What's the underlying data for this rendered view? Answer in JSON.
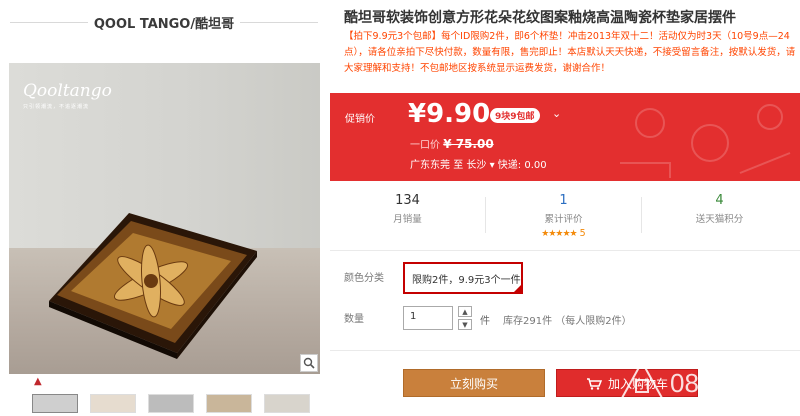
{
  "store": {
    "name": "QOOL TANGO/酷坦哥"
  },
  "gallery": {
    "brand_logo": "Qooltango",
    "brand_slogan": "只引领潮流，不追逐潮流",
    "zoom_icon": "magnifier-icon",
    "up_icon": "chevron-up-icon",
    "thumbnail_count": 5
  },
  "product": {
    "title": "酷坦哥软装饰创意方形花朵花纹图案釉烧高温陶瓷杯垫家居摆件",
    "promo_text": "【拍下9.9元3个包邮】每个ID限购2件，即6个杯垫！冲击2013年双十二！活动仅为时3天（10号9点—24点），请各位亲拍下尽快付款，数量有限，售完即止！本店默认天天快递，不接受留言备注，按默认发货，请大家理解和支持！不包邮地区按系统显示运费发货，谢谢合作！"
  },
  "price": {
    "promo_label": "促销价",
    "current": "¥9.90",
    "badge": "9块9包邮",
    "original_label": "一口价",
    "original_value": "¥ 75.00",
    "ship_from": "广东东莞",
    "to_label": "至",
    "ship_to": "长沙",
    "shipping": "快递: 0.00"
  },
  "stats": {
    "sales": {
      "value": "134",
      "label": "月销量"
    },
    "reviews": {
      "value": "1",
      "label": "累计评价",
      "stars": "★★★★★",
      "score": "5"
    },
    "points": {
      "value": "4",
      "label": "送天猫积分"
    }
  },
  "options": {
    "color_label": "颜色分类",
    "color_value": "限购2件，9.9元3个一件",
    "qty_label": "数量",
    "qty_value": "1",
    "qty_unit": "件",
    "stock": "库存291件 （每人限购2件）"
  },
  "actions": {
    "buy_now": "立刻购买",
    "add_to_cart": "加入购物车"
  },
  "watermark": {
    "text": "08 校 菜"
  },
  "colors": {
    "accent": "#e32f2f",
    "buy": "#c9803c",
    "cart": "#e02c2c",
    "promo_text": "#ff4400"
  }
}
